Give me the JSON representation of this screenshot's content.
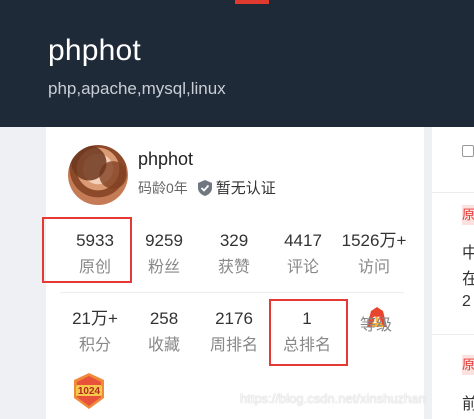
{
  "header": {
    "title": "phphot",
    "subtitle": "php,apache,mysql,linux",
    "accent_color": "#e03a2f",
    "background_color": "#1f2a38"
  },
  "profile": {
    "username": "phphot",
    "code_age": "码龄0年",
    "certification": "暂无认证",
    "certification_icon": "shield-check-icon"
  },
  "stats_row1": [
    {
      "value": "5933",
      "label": "原创"
    },
    {
      "value": "9259",
      "label": "粉丝"
    },
    {
      "value": "329",
      "label": "获赞"
    },
    {
      "value": "4417",
      "label": "评论"
    },
    {
      "value": "1526万+",
      "label": "访问"
    }
  ],
  "stats_row2": [
    {
      "value": "21万+",
      "label": "积分"
    },
    {
      "value": "258",
      "label": "收藏"
    },
    {
      "value": "2176",
      "label": "周排名"
    },
    {
      "value": "1",
      "label": "总排名"
    },
    {
      "value": "",
      "label": "等级"
    }
  ],
  "badges": {
    "level_icon": "level-11-icon",
    "level_text": "11",
    "badge_1024_icon": "badge-1024-icon",
    "badge_1024_text": "1024"
  },
  "highlight_color": "#e53935",
  "right_column": {
    "tag1": "原",
    "line1": "中",
    "line2": "在",
    "line3": "2",
    "tag2": "原",
    "line4": "前"
  },
  "watermark": "https://blog.csdn.net/xinshuzhan"
}
